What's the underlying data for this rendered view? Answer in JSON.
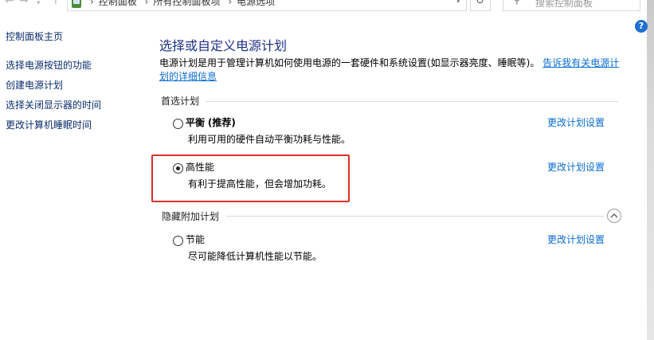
{
  "address_bar": {
    "crumbs": [
      "控制面板",
      "所有控制面板项",
      "电源选项"
    ],
    "search_placeholder": "搜索控制面板"
  },
  "left_nav": {
    "home": "控制面板主页",
    "items": [
      "选择电源按钮的功能",
      "创建电源计划",
      "选择关闭显示器的时间",
      "更改计算机睡眠时间"
    ]
  },
  "main": {
    "title": "选择或自定义电源计划",
    "description": "电源计划是用于管理计算机如何使用电源的一套硬件和系统设置(如显示器亮度、睡眠等)。",
    "description_link": "告诉我有关电源计划的详细信息",
    "preferred_label": "首选计划",
    "hidden_label": "隐藏附加计划",
    "plans": [
      {
        "name": "平衡",
        "suffix": "(推荐)",
        "desc": "利用可用的硬件自动平衡功耗与性能。",
        "link": "更改计划设置",
        "selected": false
      },
      {
        "name": "高性能",
        "suffix": "",
        "desc": "有利于提高性能，但会增加功耗。",
        "link": "更改计划设置",
        "selected": true
      },
      {
        "name": "节能",
        "suffix": "",
        "desc": "尽可能降低计算机性能以节能。",
        "link": "更改计划设置",
        "selected": false
      }
    ]
  },
  "colors": {
    "title": "#1e3287",
    "link": "#0a6cd1",
    "highlight_border": "#d9302c",
    "help_icon": "#1f6fd1"
  }
}
